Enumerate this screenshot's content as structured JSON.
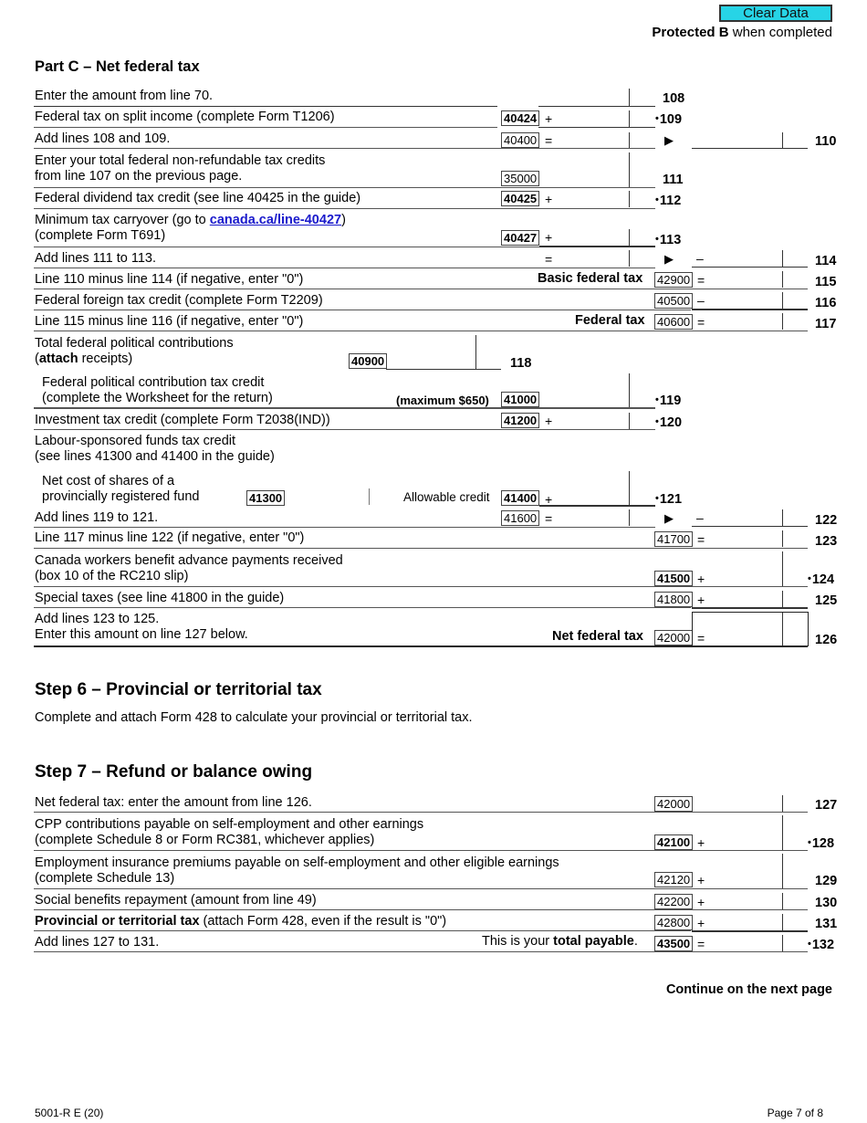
{
  "header": {
    "clear_button": "Clear Data",
    "protected_bold": "Protected B",
    "protected_rest": " when completed"
  },
  "part_c": {
    "title": "Part C – Net federal tax",
    "lines": {
      "l108": {
        "text": "Enter the amount from line 70.",
        "num": "108"
      },
      "l109": {
        "text": "Federal tax on split income (complete Form T1206)",
        "code": "40424",
        "op": "+",
        "num": "109"
      },
      "l110": {
        "text": "Add lines 108 and 109.",
        "code": "40400",
        "op": "=",
        "num": "110"
      },
      "l111": {
        "text1": "Enter your total federal non-refundable tax credits",
        "text2": "from line 107 on the previous page.",
        "code": "35000",
        "num": "111"
      },
      "l112": {
        "text": "Federal dividend tax credit (see line 40425 in the guide)",
        "code": "40425",
        "op": "+",
        "num": "112"
      },
      "l113": {
        "text1a": "Minimum tax carryover (go to ",
        "link": "canada.ca/line-40427",
        "text1b": ")",
        "text2": "(complete Form T691)",
        "code": "40427",
        "op": "+",
        "num": "113"
      },
      "l114": {
        "text": "Add lines 111 to 113.",
        "op": "=",
        "op2": "–",
        "num": "114"
      },
      "l115": {
        "text": "Line 110 minus line 114 (if negative, enter \"0\")",
        "label": "Basic federal tax",
        "code": "42900",
        "op": "=",
        "num": "115"
      },
      "l116": {
        "text": "Federal foreign tax credit (complete Form T2209)",
        "code": "40500",
        "op": "–",
        "num": "116"
      },
      "l117": {
        "text": "Line 115 minus line 116 (if negative, enter \"0\")",
        "label": "Federal tax",
        "code": "40600",
        "op": "=",
        "num": "117"
      },
      "l118": {
        "text1": "Total federal political contributions",
        "text2a": "(",
        "text2b": "attach",
        "text2c": " receipts)",
        "code": "40900",
        "num": "118"
      },
      "l119": {
        "text1": "Federal political contribution tax credit",
        "text2": "(complete the Worksheet for the return)",
        "label": "(maximum $650)",
        "code": "41000",
        "num": "119"
      },
      "l120": {
        "text": "Investment tax credit (complete Form T2038(IND))",
        "code": "41200",
        "op": "+",
        "num": "120"
      },
      "labour": {
        "text1": "Labour-sponsored funds tax credit",
        "text2": "(see lines 41300 and 41400 in the guide)"
      },
      "l121": {
        "text1": "Net cost of shares of a",
        "text2": "provincially registered fund",
        "code1": "41300",
        "label": "Allowable credit",
        "code": "41400",
        "op": "+",
        "num": "121"
      },
      "l122": {
        "text": "Add lines 119 to 121.",
        "code": "41600",
        "op": "=",
        "op2": "–",
        "num": "122"
      },
      "l123": {
        "text": "Line 117 minus line 122 (if negative, enter \"0\")",
        "code": "41700",
        "op": "=",
        "num": "123"
      },
      "l124": {
        "text1": "Canada workers benefit advance payments received",
        "text2": "(box 10 of the RC210 slip)",
        "code": "41500",
        "op": "+",
        "num": "124"
      },
      "l125": {
        "text": "Special taxes (see line 41800 in the guide)",
        "code": "41800",
        "op": "+",
        "num": "125"
      },
      "l126": {
        "text1": "Add lines 123 to 125.",
        "text2": "Enter this amount on line 127 below.",
        "label": "Net federal tax",
        "code": "42000",
        "op": "=",
        "num": "126"
      }
    }
  },
  "step6": {
    "title": "Step 6 – Provincial or territorial tax",
    "text": "Complete and attach Form 428 to calculate your provincial or territorial tax."
  },
  "step7": {
    "title": "Step 7 – Refund or balance owing",
    "lines": {
      "l127": {
        "text": "Net federal tax: enter the amount from line 126.",
        "code": "42000",
        "num": "127"
      },
      "l128": {
        "text1": "CPP contributions payable on self-employment and other earnings",
        "text2": "(complete Schedule 8 or Form RC381, whichever applies)",
        "code": "42100",
        "op": "+",
        "num": "128"
      },
      "l129": {
        "text1": "Employment insurance premiums payable on self-employment and other eligible earnings",
        "text2": "(complete Schedule 13)",
        "code": "42120",
        "op": "+",
        "num": "129"
      },
      "l130": {
        "text": "Social benefits repayment (amount from line 49)",
        "code": "42200",
        "op": "+",
        "num": "130"
      },
      "l131": {
        "bold": "Provincial or territorial tax",
        "text": " (attach Form 428, even if the result is \"0\")",
        "code": "42800",
        "op": "+",
        "num": "131"
      },
      "l132": {
        "text": "Add lines 127 to 131.",
        "label_a": "This is your ",
        "label_b": "total payable",
        "label_c": ".",
        "code": "43500",
        "op": "=",
        "num": "132"
      }
    }
  },
  "continue": "Continue on the next page",
  "footer": {
    "form_id": "5001-R E (20)",
    "page": "Page 7 of 8"
  }
}
